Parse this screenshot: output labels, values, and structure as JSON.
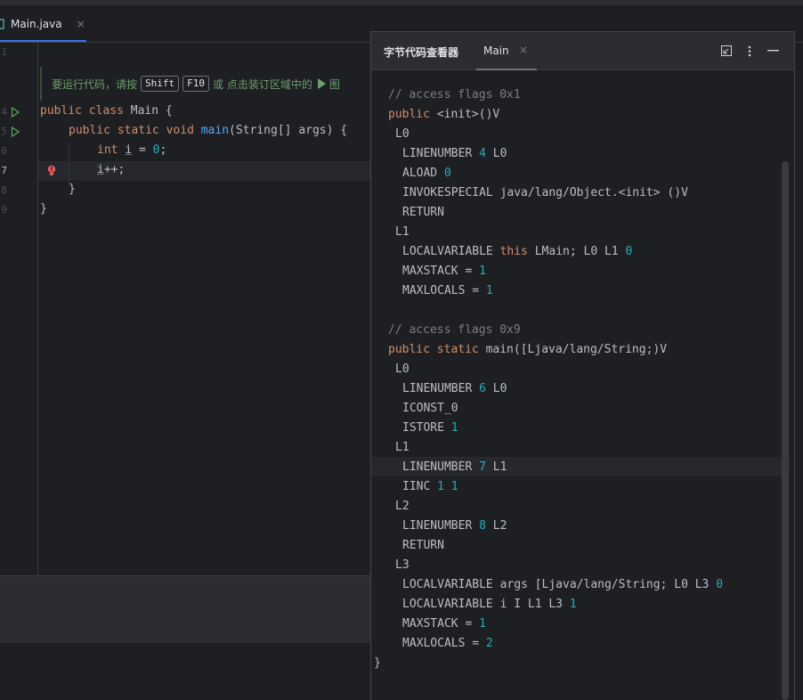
{
  "editor_tab": {
    "label": "Main.java",
    "close": "×"
  },
  "line_numbers": [
    "1",
    "4",
    "5",
    "6",
    "7",
    "8",
    "9"
  ],
  "hint": {
    "prefix": "要运行代码，请按",
    "key1": "Shift",
    "key2": "F10",
    "suffix": "或 点击装订区域中的",
    "tail": "图"
  },
  "code": {
    "l4": {
      "kw1": "public",
      "kw2": "class",
      "rest": " Main {"
    },
    "l5": {
      "kw1": "public",
      "kw2": "static",
      "kw3": "void",
      "fn": "main",
      "rest": "(String[] args) {"
    },
    "l6": {
      "kw": "int",
      "var": "i",
      "eq": " = ",
      "num": "0",
      "end": ";"
    },
    "l7": {
      "var": "i",
      "rest": "++;"
    },
    "l8": "}",
    "l9": "}"
  },
  "panel": {
    "title": "字节代码查看器",
    "tab_label": "Main",
    "tab_close": "×",
    "icons": [
      "restore-icon",
      "more-icon",
      "minimize-icon"
    ]
  },
  "bytecode": {
    "c1": "// access flags 0x1",
    "init_kw": "public",
    "init_sig": " <init>()V",
    "l0a": "L0",
    "ln4_a": "LINENUMBER ",
    "ln4_n": "4",
    "ln4_b": " L0",
    "aload_a": "ALOAD ",
    "aload_n": "0",
    "invoke": "INVOKESPECIAL java/lang/Object.<init> ()V",
    "ret1": "RETURN",
    "l1a": "L1",
    "lv_this_a": "LOCALVARIABLE ",
    "lv_this_kw": "this",
    "lv_this_b": " LMain; L0 L1 ",
    "lv_this_n": "0",
    "ms1_a": "MAXSTACK = ",
    "ms1_n": "1",
    "ml1_a": "MAXLOCALS = ",
    "ml1_n": "1",
    "c2": "// access flags 0x9",
    "main_kw": "public static",
    "main_sig": " main([Ljava/lang/String;)V",
    "l0b": "L0",
    "ln6_a": "LINENUMBER ",
    "ln6_n": "6",
    "ln6_b": " L0",
    "iconst": "ICONST_0",
    "istore_a": "ISTORE ",
    "istore_n": "1",
    "l1b": "L1",
    "ln7_a": "LINENUMBER ",
    "ln7_n": "7",
    "ln7_b": " L1",
    "iinc_a": "IINC ",
    "iinc_n1": "1",
    "iinc_n2": "1",
    "l2": "L2",
    "ln8_a": "LINENUMBER ",
    "ln8_n": "8",
    "ln8_b": " L2",
    "ret2": "RETURN",
    "l3": "L3",
    "lv_args_a": "LOCALVARIABLE args [Ljava/lang/String; L0 L3 ",
    "lv_args_n": "0",
    "lv_i_a": "LOCALVARIABLE i I L1 L3 ",
    "lv_i_n": "1",
    "ms2_a": "MAXSTACK = ",
    "ms2_n": "1",
    "ml2_a": "MAXLOCALS = ",
    "ml2_n": "2",
    "close_brace": "}"
  }
}
